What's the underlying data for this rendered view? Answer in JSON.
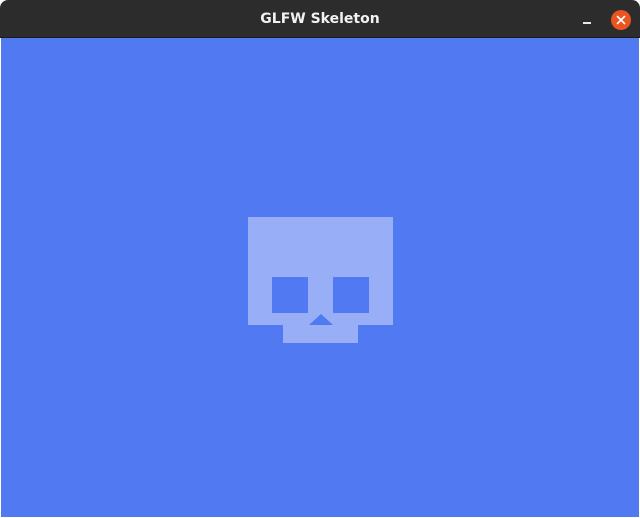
{
  "window": {
    "title": "GLFW Skeleton"
  },
  "controls": {
    "minimize_icon": "minimize-icon",
    "close_icon": "close-icon",
    "close_color": "#e95420"
  },
  "canvas": {
    "background_color": "#5079f2",
    "logo_icon": "skull-icon",
    "logo_color": "#98aff7"
  }
}
